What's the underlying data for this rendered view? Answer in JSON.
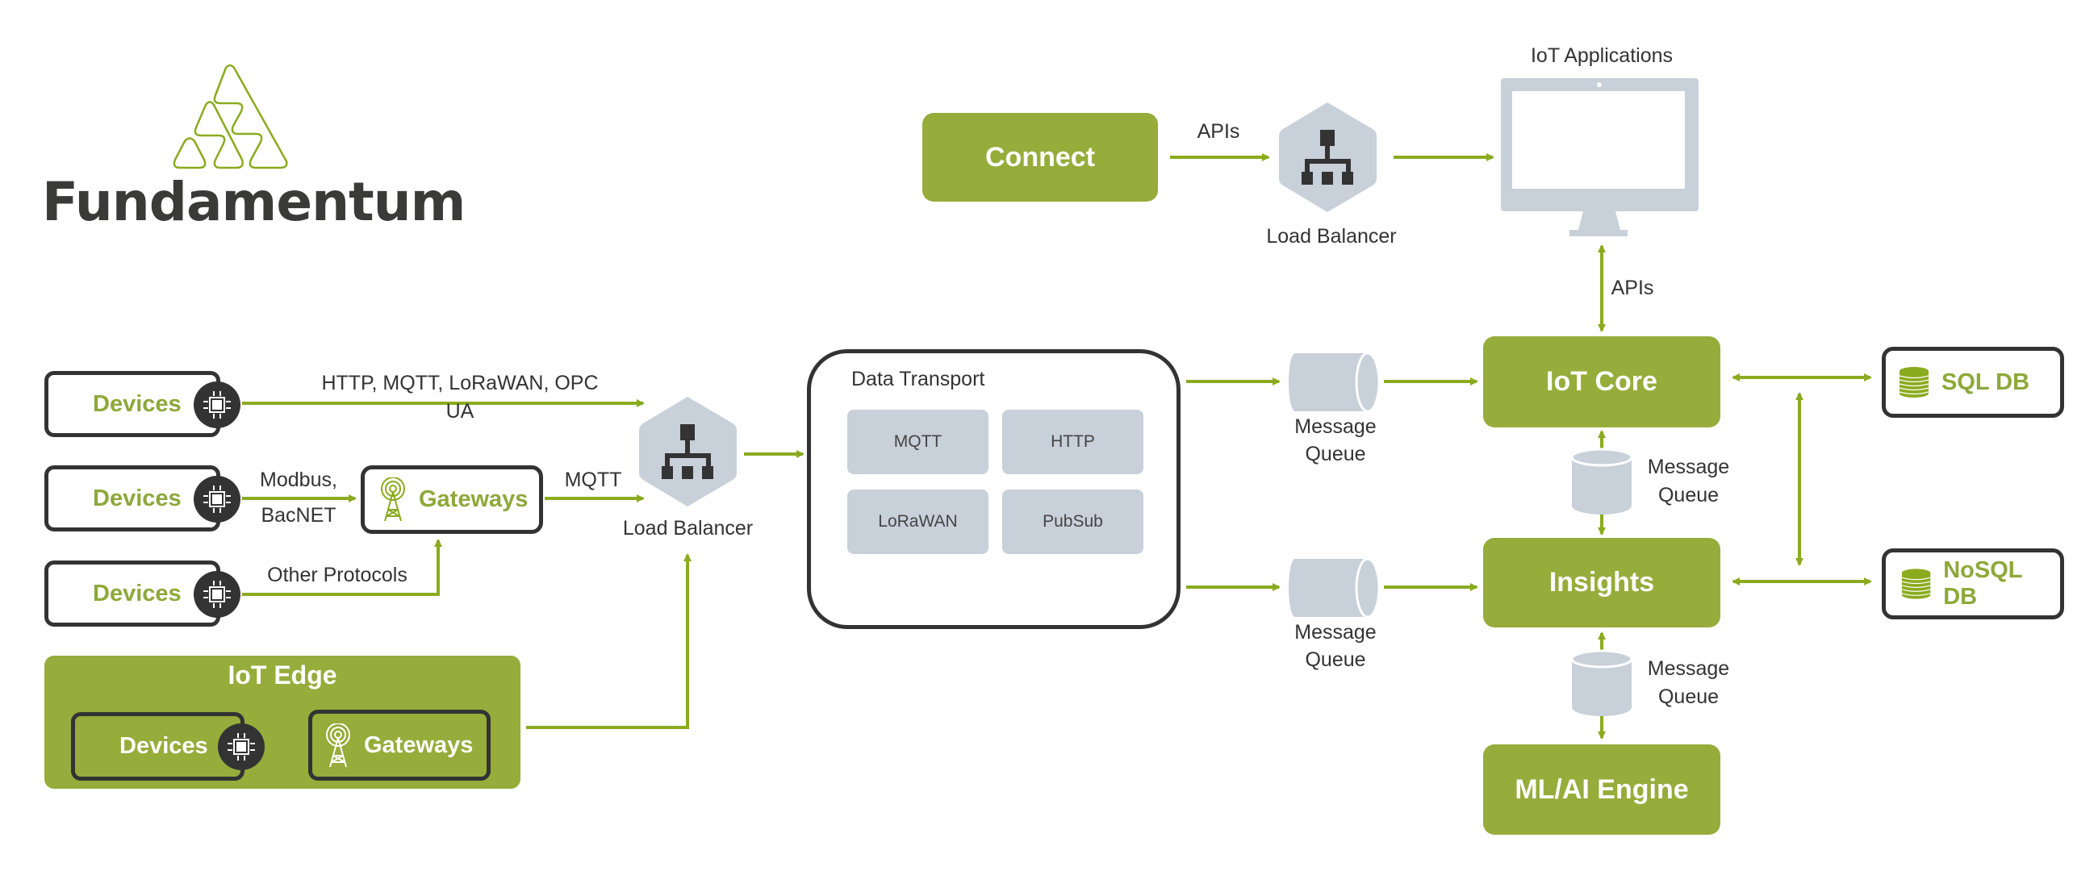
{
  "brand": {
    "name": "Fundamentum",
    "accent": "#96ac3b",
    "dark": "#3a3b39",
    "gray": "#c8d0da"
  },
  "top": {
    "connect_label": "Connect",
    "apis_label": "APIs",
    "load_balancer_label": "Load Balancer",
    "iot_applications_label": "IoT Applications",
    "apis_vertical_label": "APIs"
  },
  "left": {
    "devices": [
      {
        "label": "Devices",
        "protocol": "HTTP, MQTT, LoRaWAN, OPC UA"
      },
      {
        "label": "Devices",
        "protocol_line1": "Modbus,",
        "protocol_line2": "BacNET"
      },
      {
        "label": "Devices",
        "protocol": "Other Protocols"
      }
    ],
    "gateways_label": "Gateways",
    "gateway_protocol": "MQTT",
    "load_balancer_label": "Load Balancer"
  },
  "iot_edge": {
    "title": "IoT Edge",
    "devices_label": "Devices",
    "gateways_label": "Gateways"
  },
  "data_transport": {
    "title": "Data Transport",
    "protocols": [
      "MQTT",
      "HTTP",
      "LoRaWAN",
      "PubSub"
    ]
  },
  "queues": {
    "line1": "Message",
    "line2": "Queue"
  },
  "services": {
    "iot_core": "IoT Core",
    "insights": "Insights",
    "ml_ai": "ML/AI Engine"
  },
  "databases": {
    "sql": "SQL DB",
    "nosql": "NoSQL DB"
  }
}
